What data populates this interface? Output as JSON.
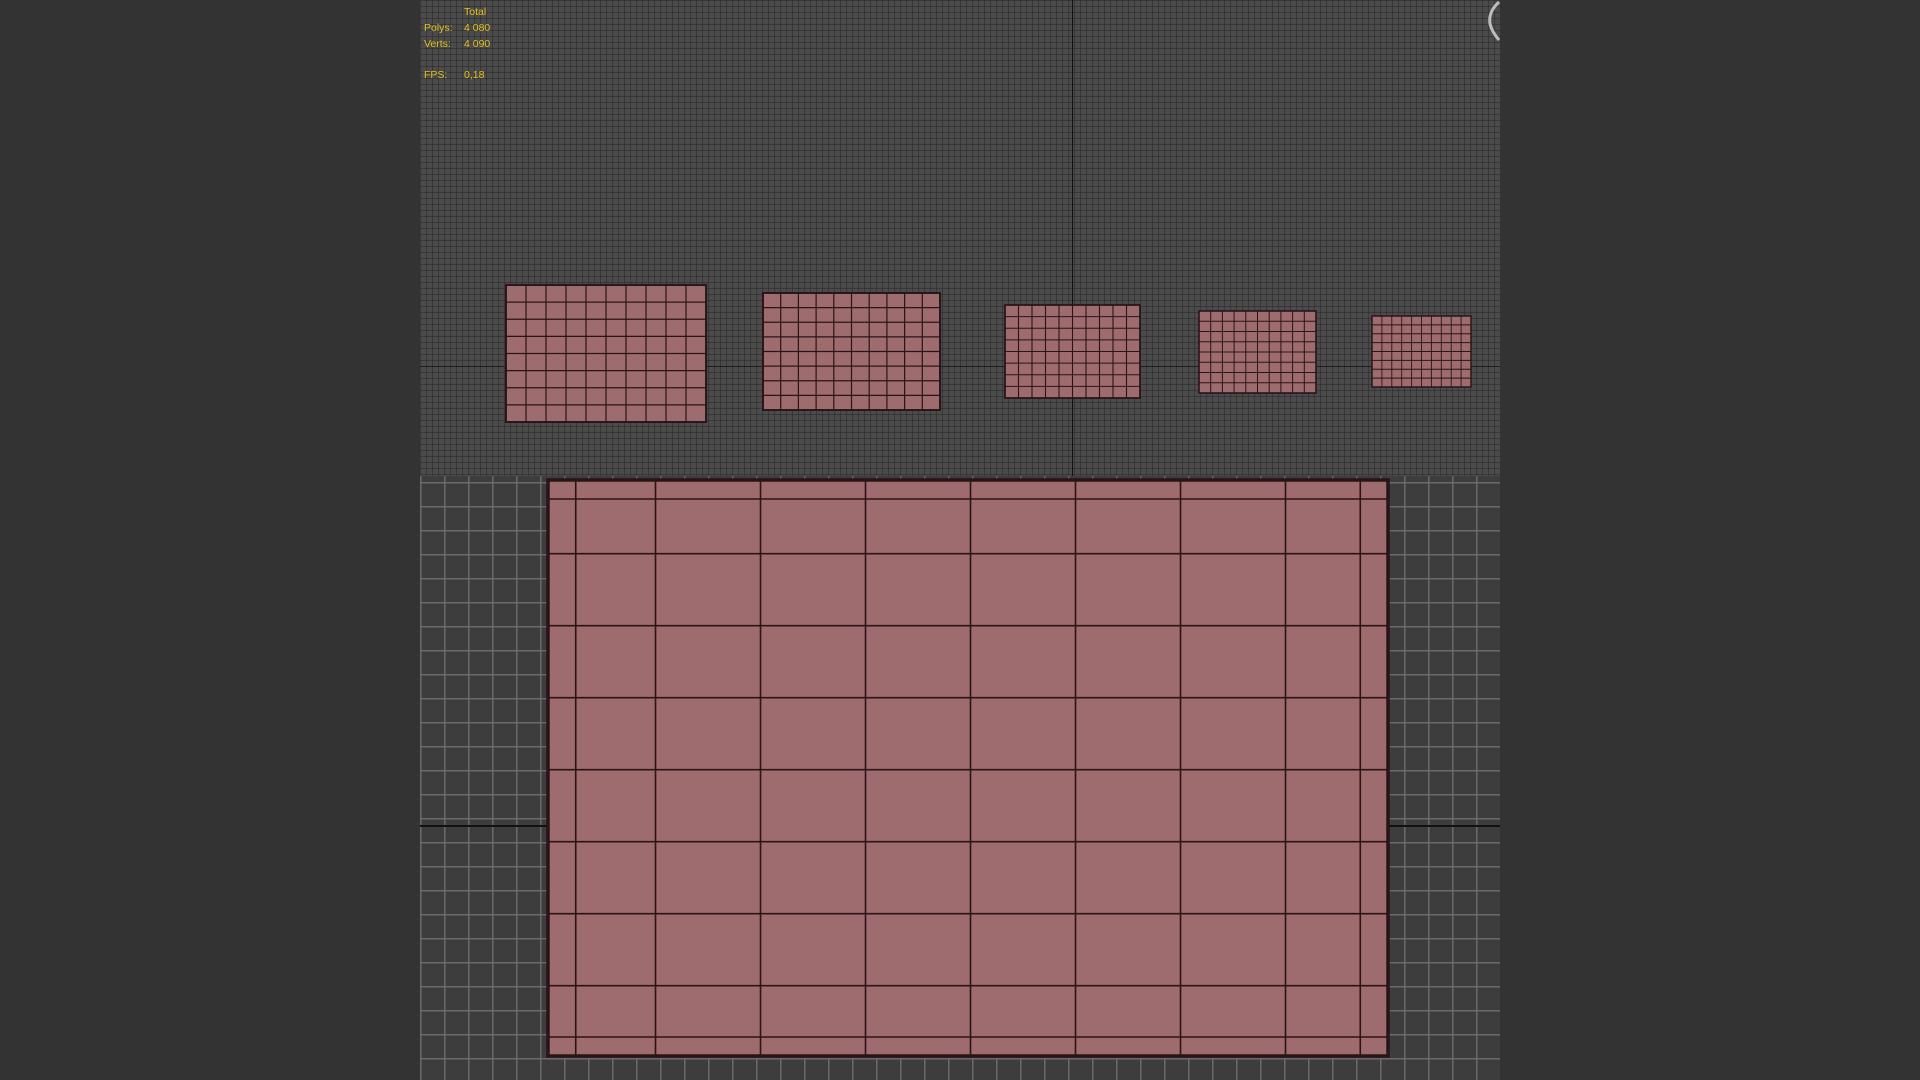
{
  "viewport": {
    "background_color": "#333333",
    "mesh_fill_color": "#9e6b6f",
    "mesh_wire_color": "#2a1416",
    "stats_color": "#e2c21d",
    "stats": {
      "header": "Total",
      "polys_label": "Polys:",
      "polys_value": "4 080",
      "verts_label": "Verts:",
      "verts_value": "4 090",
      "fps_label": "FPS:",
      "fps_value": "0,18"
    },
    "nav_icon": "viewcube-arc-icon"
  }
}
